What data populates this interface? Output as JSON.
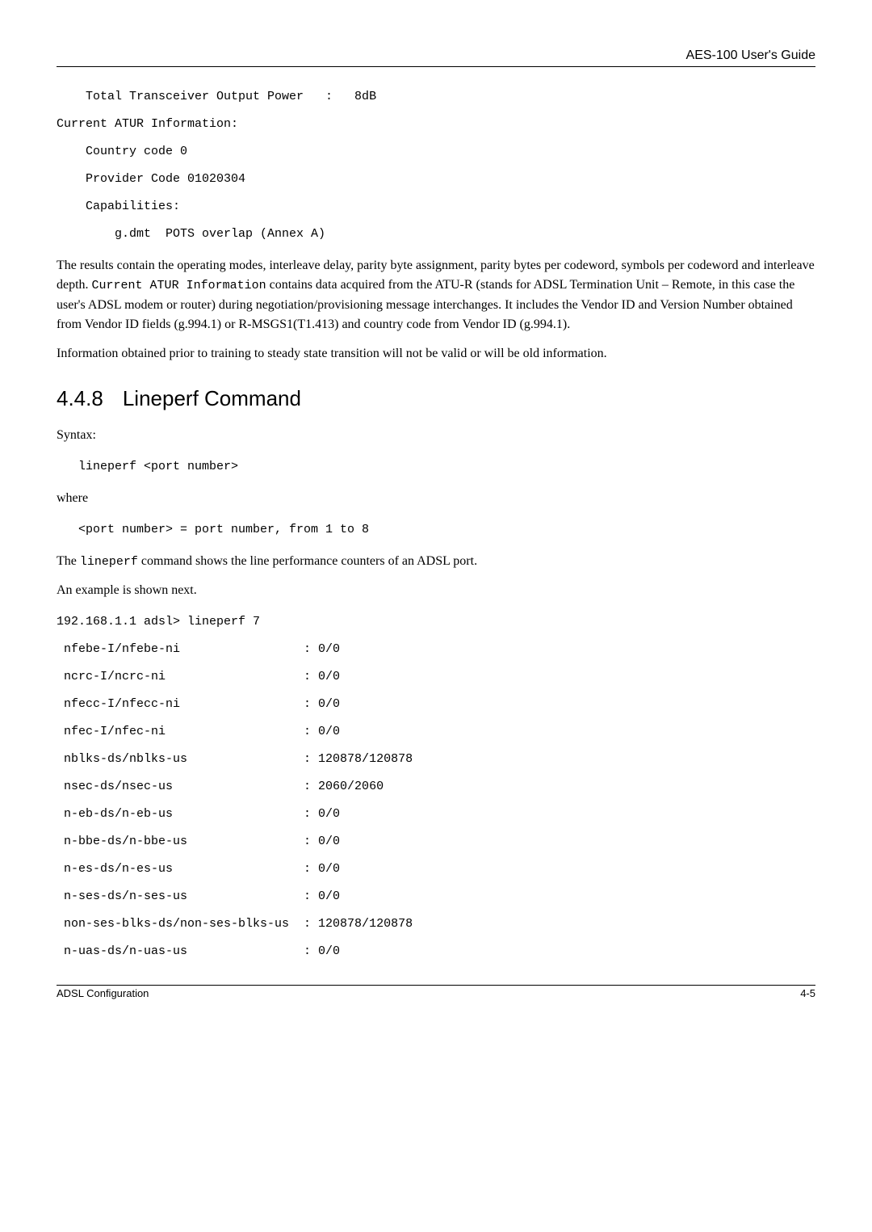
{
  "header": {
    "title": "AES-100 User's Guide"
  },
  "codeBlock1": {
    "l1": "    Total Transceiver Output Power   :   8dB",
    "l2": "Current ATUR Information:",
    "l3": "    Country code 0",
    "l4": "    Provider Code 01020304",
    "l5": "    Capabilities:",
    "l6": "        g.dmt  POTS overlap (Annex A)"
  },
  "para1": {
    "pre": "The results contain the operating modes, interleave delay, parity byte assignment, parity bytes per codeword, symbols per codeword and interleave depth. ",
    "code": "Current ATUR Information",
    "post": " contains data acquired from the ATU-R (stands for ADSL Termination Unit – Remote, in this case the user's ADSL modem or router) during negotiation/provisioning message interchanges. It includes the Vendor ID and Version Number obtained from Vendor ID fields (g.994.1) or R-MSGS1(T1.413) and country code from Vendor ID (g.994.1)."
  },
  "para2": "Information obtained prior to training to steady state transition will not be valid or will be old information.",
  "section": {
    "num": "4.4.8",
    "title": "Lineperf Command"
  },
  "syntaxLabel": "Syntax:",
  "syntaxCode": "   lineperf <port number>",
  "whereLabel": "where",
  "whereCode": "   <port number> = port number, from 1 to 8",
  "para3": {
    "pre": "The ",
    "code": "lineperf",
    "post": " command shows the line performance counters of an ADSL port."
  },
  "exampleLabel": "An example is shown next.",
  "codeBlock2": {
    "l0": "192.168.1.1 adsl> lineperf 7",
    "l1": " nfebe-I/nfebe-ni                 : 0/0",
    "l2": " ncrc-I/ncrc-ni                   : 0/0",
    "l3": " nfecc-I/nfecc-ni                 : 0/0",
    "l4": " nfec-I/nfec-ni                   : 0/0",
    "l5": " nblks-ds/nblks-us                : 120878/120878",
    "l6": " nsec-ds/nsec-us                  : 2060/2060",
    "l7": " n-eb-ds/n-eb-us                  : 0/0",
    "l8": " n-bbe-ds/n-bbe-us                : 0/0",
    "l9": " n-es-ds/n-es-us                  : 0/0",
    "l10": " n-ses-ds/n-ses-us                : 0/0",
    "l11": " non-ses-blks-ds/non-ses-blks-us  : 120878/120878",
    "l12": " n-uas-ds/n-uas-us                : 0/0"
  },
  "footer": {
    "left": "ADSL Configuration",
    "right": "4-5"
  }
}
